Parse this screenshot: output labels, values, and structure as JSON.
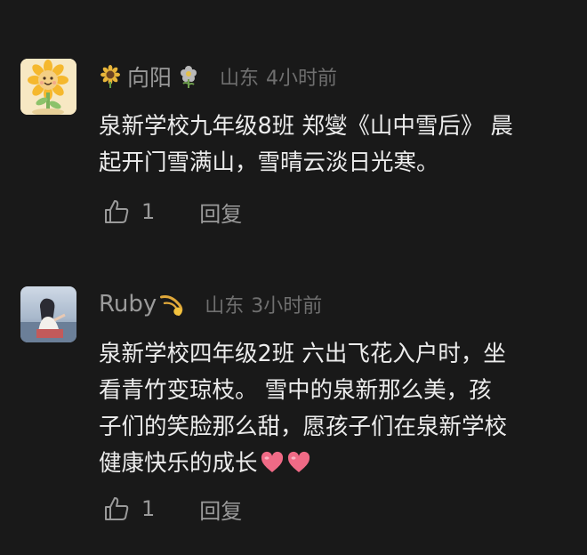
{
  "comments": [
    {
      "username": "向阳",
      "location": "山东",
      "time": "4小时前",
      "content": "泉新学校九年级8班 郑燮《山中雪后》 晨\n起开门雪满山，雪晴云淡日光寒。",
      "likes": "1",
      "reply_label": "回复",
      "avatar_icon": "sunflower-avatar",
      "name_prefix_icon": "sunflower-icon",
      "name_suffix_icon": "flower-icon"
    },
    {
      "username": "Ruby",
      "location": "山东",
      "time": "3小时前",
      "content": "泉新学校四年级2班 六出飞花入户时，坐\n看青竹变琼枝。 雪中的泉新那么美，孩\n子们的笑脸那么甜，愿孩子们在泉新学校\n健康快乐的成长",
      "likes": "1",
      "reply_label": "回复",
      "avatar_icon": "girl-photo-avatar",
      "name_suffix_icon": "comet-icon",
      "trailing_icons": [
        "heart-icon",
        "heart-icon"
      ]
    }
  ],
  "colors": {
    "background": "#191919",
    "text_primary": "#ececec",
    "text_secondary": "#9a9a9a",
    "text_meta": "#6f6f6f",
    "heart": "#f06a86"
  }
}
